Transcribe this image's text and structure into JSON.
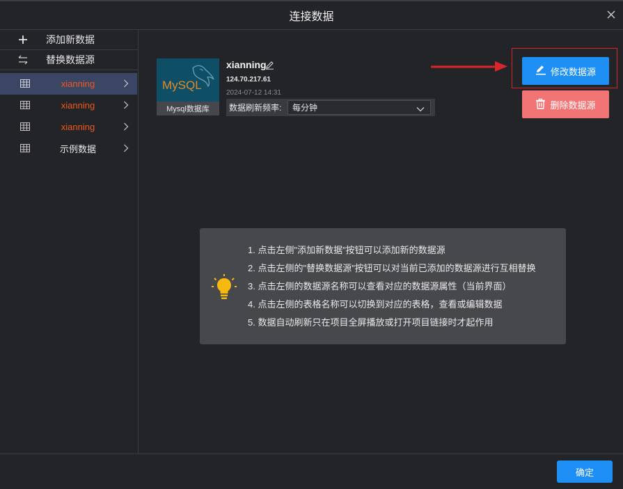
{
  "dialog": {
    "title": "连接数据",
    "close_icon": "close-icon"
  },
  "sidebar": {
    "actions": [
      {
        "label": "添加新数据",
        "icon": "plus-icon"
      },
      {
        "label": "替换数据源",
        "icon": "swap-icon"
      }
    ],
    "items": [
      {
        "label": "xianning",
        "active": true,
        "color": "#f2571d"
      },
      {
        "label": "xianning",
        "active": false,
        "color": "#f2571d"
      },
      {
        "label": "xianning",
        "active": false,
        "color": "#f2571d"
      },
      {
        "label": "示例数据",
        "active": false,
        "color": "#e8e8e8"
      }
    ]
  },
  "datasource": {
    "name": "xianning",
    "ip": "124.70.217.61",
    "date": "2024-07-12 14:31",
    "logo_text": "MySQL",
    "logo_caption": "Mysql数据库",
    "refresh_label": "数据刷新频率:",
    "refresh_value": "每分钟"
  },
  "buttons": {
    "edit_label": "修改数据源",
    "delete_label": "删除数据源",
    "ok_label": "确定"
  },
  "tips": [
    "1. 点击左侧\"添加新数据\"按钮可以添加新的数据源",
    "2. 点击左侧的\"替换数据源\"按钮可以对当前已添加的数据源进行互相替换",
    "3. 点击左侧的数据源名称可以查看对应的数据源属性（当前界面）",
    "4. 点击左侧的表格名称可以切换到对应的表格，查看或编辑数据",
    "5. 数据自动刷新只在项目全屏播放或打开项目链接时才起作用"
  ],
  "colors": {
    "accent": "#1e8ff5",
    "danger": "#f27474",
    "annotation_red": "#d9262c",
    "active_item_bg": "#3b4665"
  }
}
